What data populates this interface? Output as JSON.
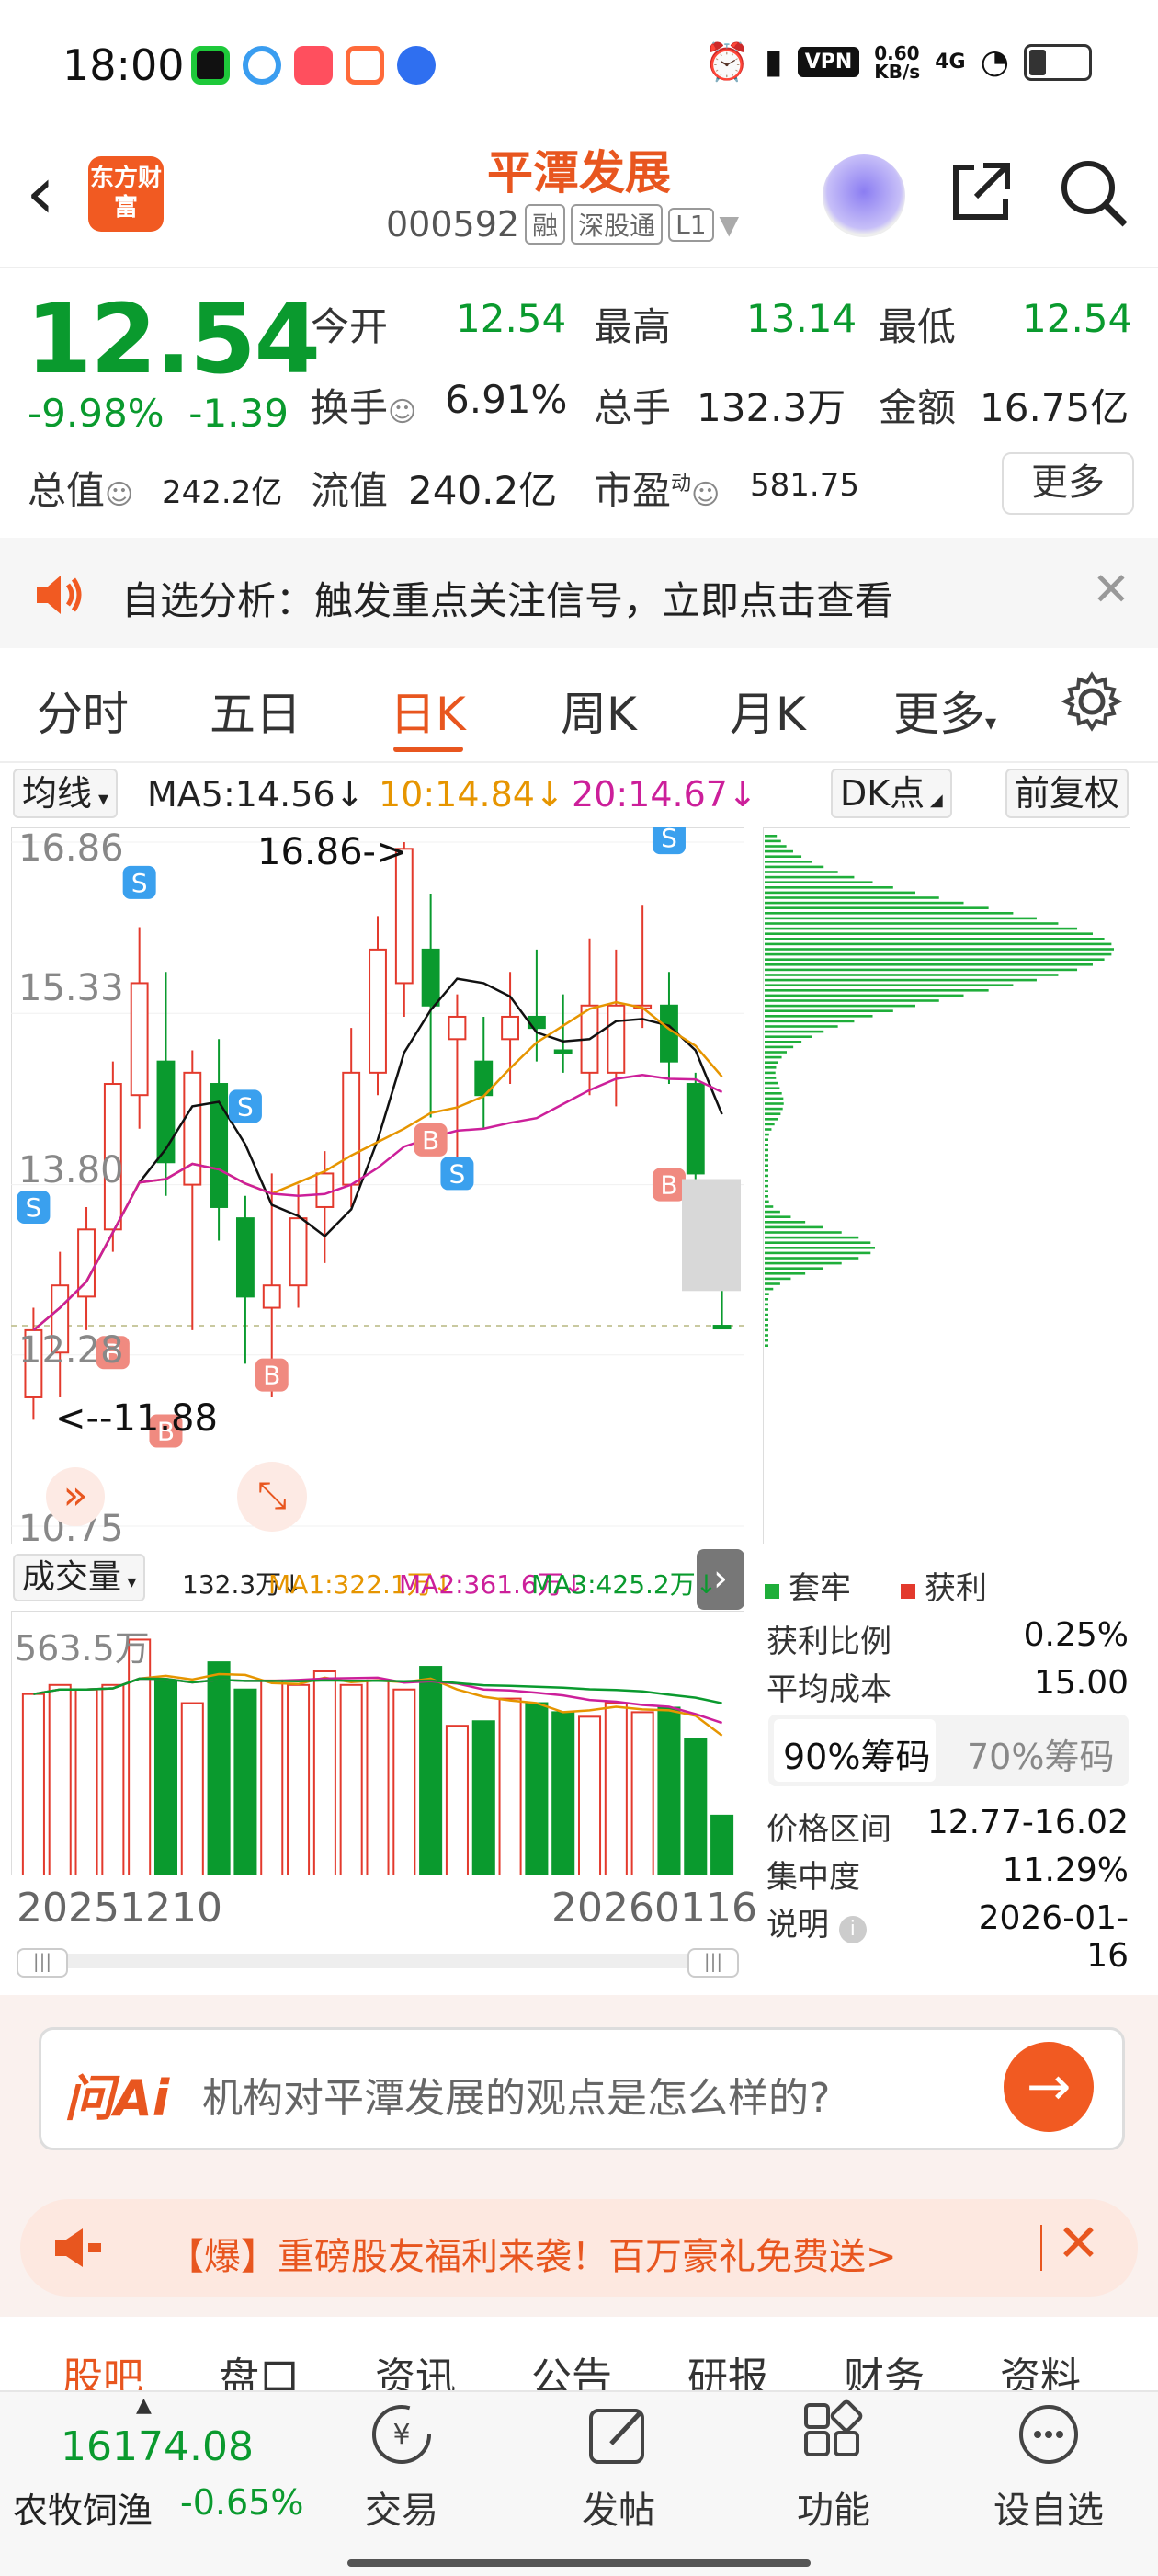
{
  "status_bar": {
    "time": "18:00",
    "vpn": "VPN",
    "net_speed": "0.60",
    "net_unit": "KB/s",
    "signal": "4G"
  },
  "header": {
    "logo_text": "东方财富",
    "stock_name": "平潭发展",
    "stock_code": "000592",
    "tags": [
      "融",
      "深股通",
      "L1"
    ]
  },
  "quote": {
    "price": "12.54",
    "change_pct": "-9.98%",
    "change": "-1.39",
    "open_label": "今开",
    "open": "12.54",
    "high_label": "最高",
    "high": "13.14",
    "low_label": "最低",
    "low": "12.54",
    "turnover_label": "换手",
    "turnover": "6.91%",
    "volume_label": "总手",
    "volume": "132.3万",
    "amount_label": "金额",
    "amount": "16.75亿",
    "mcap_label": "总值",
    "mcap": "242.2亿",
    "float_label": "流值",
    "float": "240.2亿",
    "pe_label": "市盈",
    "pe_sup": "动",
    "pe": "581.75",
    "more": "更多"
  },
  "notice": {
    "text": "自选分析：触发重点关注信号，立即点击查看"
  },
  "tabs": [
    "分时",
    "五日",
    "日K",
    "周K",
    "月K",
    "更多"
  ],
  "active_tab": "日K",
  "ma_legend": {
    "selector": "均线",
    "ma5": "MA5:14.56",
    "ma10": "10:14.84",
    "ma20": "20:14.67",
    "dk": "DK点",
    "fq": "前复权"
  },
  "kchart_labels": {
    "y1": "16.86",
    "y2": "15.33",
    "y3": "13.80",
    "y4": "12.28",
    "y5": "10.75",
    "max_note": "16.86->",
    "min_note": "<--11.88"
  },
  "volume_legend": {
    "selector": "成交量",
    "vol": "132.3万",
    "ma1": "MA1:322.1万",
    "ma2": "MA2:361.6万",
    "ma3": "MA3:425.2万",
    "max_label": "563.5万"
  },
  "dates": {
    "start": "20251210",
    "end": "20260116"
  },
  "chip": {
    "legend_trapped": "套牢",
    "legend_profit": "获利",
    "profit_ratio_label": "获利比例",
    "profit_ratio": "0.25%",
    "avg_cost_label": "平均成本",
    "avg_cost": "15.00",
    "tab_90": "90%筹码",
    "tab_70": "70%筹码",
    "range_label": "价格区间",
    "range": "12.77-16.02",
    "concentration_label": "集中度",
    "concentration": "11.29%",
    "note_label": "说明",
    "note_date": "2026-01-16"
  },
  "ai": {
    "logo": "问Ai",
    "question": "机构对平潭发展的观点是怎么样的?"
  },
  "promo": {
    "text": "【爆】重磅股友福利来袭！百万豪礼免费送>"
  },
  "sub_tabs": [
    "股吧",
    "盘口",
    "资讯",
    "公告",
    "研报",
    "财务",
    "资料"
  ],
  "bottom": {
    "index_value": "16174.08",
    "index_name": "农牧饲渔",
    "index_change": "-0.65%",
    "nav": [
      "交易",
      "发帖",
      "功能",
      "设自选"
    ]
  },
  "colors": {
    "accent": "#e8561f",
    "down": "#0a9a2e",
    "up": "#e33a2d"
  },
  "chart_data": {
    "type": "candlestick",
    "y_axis_ticks": [
      16.86,
      15.33,
      13.8,
      12.28,
      10.75
    ],
    "ylim": [
      10.75,
      16.86
    ],
    "candles": [
      {
        "o": 11.9,
        "c": 12.5,
        "h": 12.7,
        "l": 11.7,
        "up": true
      },
      {
        "o": 12.3,
        "c": 12.9,
        "h": 13.2,
        "l": 11.9,
        "up": true
      },
      {
        "o": 12.8,
        "c": 13.4,
        "h": 13.6,
        "l": 12.5,
        "up": true
      },
      {
        "o": 13.4,
        "c": 14.7,
        "h": 14.9,
        "l": 13.2,
        "up": true
      },
      {
        "o": 14.6,
        "c": 15.6,
        "h": 16.1,
        "l": 14.3,
        "up": true
      },
      {
        "o": 14.9,
        "c": 14.0,
        "h": 15.7,
        "l": 13.7,
        "up": false
      },
      {
        "o": 13.8,
        "c": 14.8,
        "h": 15.0,
        "l": 12.5,
        "up": true
      },
      {
        "o": 14.7,
        "c": 13.6,
        "h": 15.1,
        "l": 13.3,
        "up": false
      },
      {
        "o": 13.5,
        "c": 12.8,
        "h": 13.7,
        "l": 12.2,
        "up": false
      },
      {
        "o": 12.7,
        "c": 12.9,
        "h": 13.9,
        "l": 11.9,
        "up": true
      },
      {
        "o": 12.9,
        "c": 13.5,
        "h": 13.8,
        "l": 12.7,
        "up": true
      },
      {
        "o": 13.6,
        "c": 13.9,
        "h": 14.1,
        "l": 13.1,
        "up": true
      },
      {
        "o": 13.8,
        "c": 14.8,
        "h": 15.2,
        "l": 13.6,
        "up": true
      },
      {
        "o": 14.8,
        "c": 15.9,
        "h": 16.2,
        "l": 14.6,
        "up": true
      },
      {
        "o": 15.6,
        "c": 16.8,
        "h": 16.86,
        "l": 15.3,
        "up": true
      },
      {
        "o": 15.9,
        "c": 15.4,
        "h": 16.4,
        "l": 14.4,
        "up": false
      },
      {
        "o": 15.1,
        "c": 15.3,
        "h": 15.5,
        "l": 14.0,
        "up": true
      },
      {
        "o": 14.9,
        "c": 14.6,
        "h": 15.3,
        "l": 14.3,
        "up": false
      },
      {
        "o": 15.1,
        "c": 15.3,
        "h": 15.7,
        "l": 14.7,
        "up": true
      },
      {
        "o": 15.3,
        "c": 15.2,
        "h": 15.9,
        "l": 14.9,
        "up": false
      },
      {
        "o": 15.0,
        "c": 15.0,
        "h": 15.5,
        "l": 14.8,
        "up": false
      },
      {
        "o": 14.8,
        "c": 15.4,
        "h": 16.0,
        "l": 14.6,
        "up": true
      },
      {
        "o": 14.8,
        "c": 15.4,
        "h": 15.9,
        "l": 14.5,
        "up": true
      },
      {
        "o": 15.4,
        "c": 15.4,
        "h": 16.3,
        "l": 15.2,
        "up": true
      },
      {
        "o": 15.4,
        "c": 14.9,
        "h": 15.7,
        "l": 14.7,
        "up": false
      },
      {
        "o": 14.7,
        "c": 13.9,
        "h": 14.8,
        "l": 12.9,
        "up": false
      },
      {
        "o": 12.54,
        "c": 12.54,
        "h": 13.14,
        "l": 12.54,
        "up": false
      }
    ],
    "volume_unit": "万",
    "volume": [
      400,
      420,
      410,
      420,
      520,
      430,
      380,
      470,
      410,
      430,
      420,
      450,
      420,
      430,
      410,
      460,
      330,
      340,
      390,
      380,
      360,
      350,
      380,
      360,
      370,
      300,
      132
    ]
  }
}
